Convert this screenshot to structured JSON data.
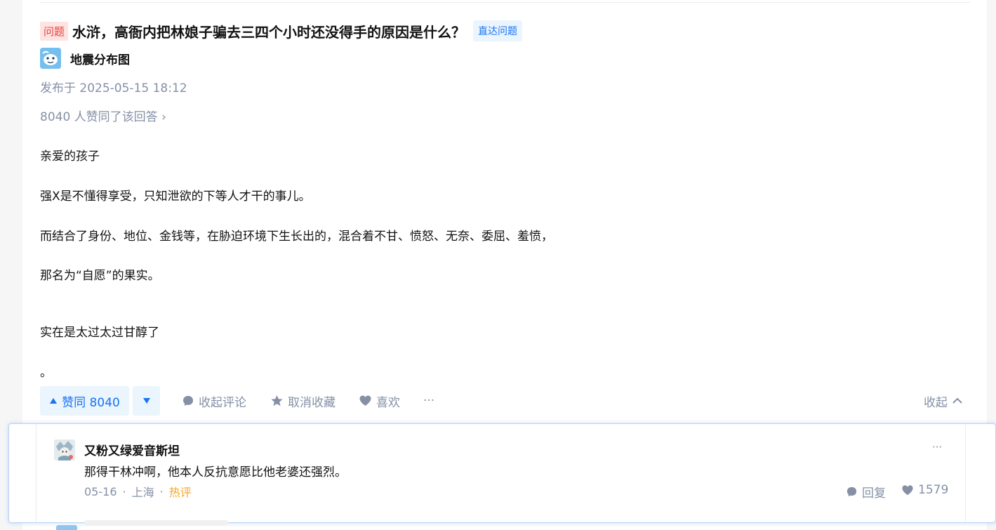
{
  "question": {
    "tag": "问题",
    "title": "水浒，高衙内把林娘子骗去三四个小时还没得手的原因是什么？",
    "link_label": "直达问题"
  },
  "author": {
    "name": "地震分布图",
    "avatar_icon": "cartoon-whale-avatar"
  },
  "meta": {
    "published": "发布于 2025-05-15 18:12",
    "votes_summary": "8040 人赞同了该回答 ›"
  },
  "content": {
    "paragraphs": [
      "亲爱的孩子",
      "强X是不懂得享受，只知泄欲的下等人才干的事儿。",
      "而结合了身份、地位、金钱等，在胁迫环境下生长出的，混合着不甘、愤怒、无奈、委屈、羞愤，",
      "那名为“自愿”的果实。",
      "实在是太过太过甘醇了",
      "。"
    ]
  },
  "actions": {
    "upvote_label": "赞同 8040",
    "downvote_icon": "triangle-down-icon",
    "comment_label": "收起评论",
    "collect_label": "取消收藏",
    "like_label": "喜欢",
    "more_label": "···",
    "collapse_label": "收起"
  },
  "comment": {
    "author": "又粉又绿爱音斯坦",
    "text": "那得干林冲啊，他本人反抗意愿比他老婆还强烈。",
    "date": "05-16",
    "location": "上海",
    "hot_label": "热评",
    "reply_label": "回复",
    "like_count": "1579",
    "more_label": "···",
    "dot": "·"
  },
  "colors": {
    "accent": "#1772f6",
    "accent_bg": "#ebf5fd",
    "muted": "#8590a6",
    "tag_red": "#f1403c",
    "hot_orange": "#f5a623"
  }
}
